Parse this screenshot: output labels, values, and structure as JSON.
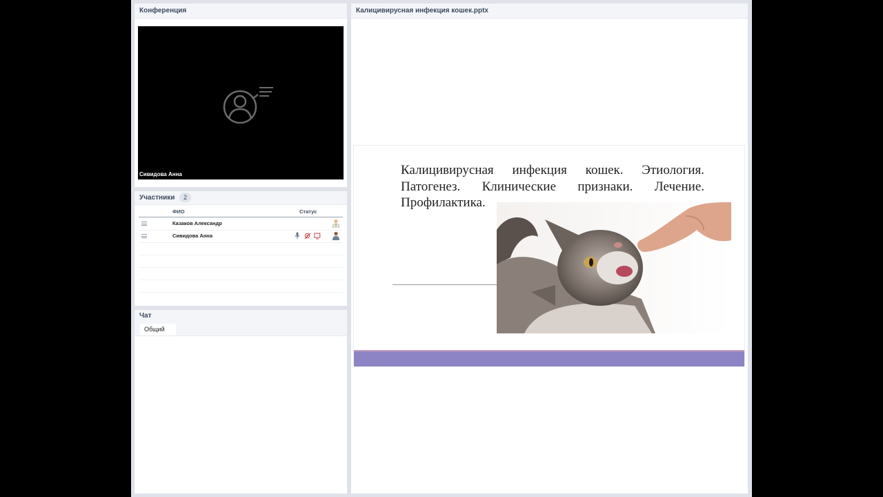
{
  "conference": {
    "title": "Конференция",
    "video_user": "Сивидова Анна"
  },
  "participants": {
    "title": "Участники",
    "count": "2",
    "columns": {
      "fio": "ФИО",
      "status": "Статус"
    },
    "rows": [
      {
        "name": "Казаков Александр",
        "status_icons": [
          "presenter-avatar-icon"
        ]
      },
      {
        "name": "Сивидова Анна",
        "status_icons": [
          "microphone-icon",
          "camera-off-icon",
          "screen-off-icon",
          "user-avatar-icon"
        ]
      }
    ]
  },
  "chat": {
    "title": "Чат",
    "tab": "Общий"
  },
  "presentation": {
    "filename": "Калицивирусная инфекция кошек.pptx",
    "slide_title": "Калицивирусная инфекция кошек. Этиология. Патогенез. Клинические признаки. Лечение. Профилактика.",
    "band_color": "#8c84c4"
  }
}
